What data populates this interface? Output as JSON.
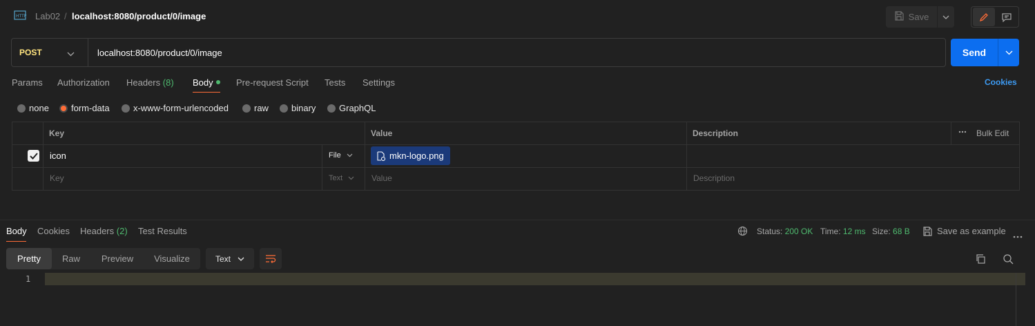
{
  "header": {
    "icon": "http-request-icon",
    "collection": "Lab02",
    "separator": "/",
    "request_name": "localhost:8080/product/0/image",
    "save_label": "Save"
  },
  "request": {
    "method": "POST",
    "url": "localhost:8080/product/0/image",
    "send_label": "Send"
  },
  "tabs": [
    {
      "label": "Params"
    },
    {
      "label": "Authorization"
    },
    {
      "label": "Headers",
      "count": "(8)"
    },
    {
      "label": "Body",
      "active": true
    },
    {
      "label": "Pre-request Script"
    },
    {
      "label": "Tests"
    },
    {
      "label": "Settings"
    }
  ],
  "cookies_label": "Cookies",
  "body_types": [
    {
      "label": "none"
    },
    {
      "label": "form-data",
      "selected": true
    },
    {
      "label": "x-www-form-urlencoded"
    },
    {
      "label": "raw"
    },
    {
      "label": "binary"
    },
    {
      "label": "GraphQL"
    }
  ],
  "table": {
    "headers": {
      "key": "Key",
      "value": "Value",
      "description": "Description",
      "bulk_edit": "Bulk Edit"
    },
    "rows": [
      {
        "checked": true,
        "key": "icon",
        "type": "File",
        "value": "mkn-logo.png",
        "description": ""
      }
    ],
    "placeholder": {
      "key": "Key",
      "type": "Text",
      "value": "Value",
      "description": "Description"
    }
  },
  "response": {
    "tabs": [
      {
        "label": "Body",
        "active": true
      },
      {
        "label": "Cookies"
      },
      {
        "label": "Headers",
        "count": "(2)"
      },
      {
        "label": "Test Results"
      }
    ],
    "status_label": "Status:",
    "status_value": "200 OK",
    "time_label": "Time:",
    "time_value": "12 ms",
    "size_label": "Size:",
    "size_value": "68 B",
    "save_example": "Save as example",
    "views": [
      "Pretty",
      "Raw",
      "Preview",
      "Visualize"
    ],
    "active_view": "Pretty",
    "format": "Text",
    "line_number": "1"
  },
  "colors": {
    "background": "#212121",
    "accent_orange": "#ff6c37",
    "send_blue": "#0c6ef0",
    "status_green": "#4fba6f",
    "method_yellow": "#ffe47e",
    "link_blue": "#3d9bf3"
  }
}
